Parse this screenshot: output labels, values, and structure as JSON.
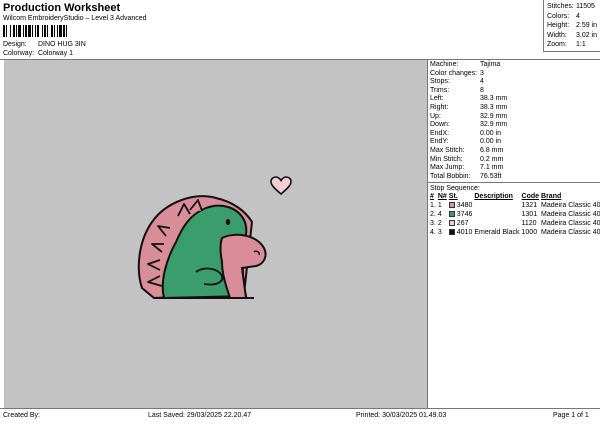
{
  "header": {
    "title": "Production Worksheet",
    "subtitle": "Wilcom EmbroideryStudio – Level 3 Advanced",
    "design_label": "Design:",
    "design_value": "DINO HUG 3IN",
    "colorway_label": "Colorway:",
    "colorway_value": "Colorway 1"
  },
  "stats": [
    {
      "label": "Stitches:",
      "value": "11505"
    },
    {
      "label": "Colors:",
      "value": "4"
    },
    {
      "label": "Height:",
      "value": "2.59 in"
    },
    {
      "label": "Width:",
      "value": "3.02 in"
    },
    {
      "label": "Zoom:",
      "value": "1:1"
    }
  ],
  "params": [
    {
      "label": "Machine:",
      "value": "Tajima"
    },
    {
      "label": "Color changes:",
      "value": "3"
    },
    {
      "label": "Stops:",
      "value": "4"
    },
    {
      "label": "Trims:",
      "value": "8"
    },
    {
      "label": "Left:",
      "value": "38.3 mm"
    },
    {
      "label": "Right:",
      "value": "38.3 mm"
    },
    {
      "label": "Up:",
      "value": "32.9 mm"
    },
    {
      "label": "Down:",
      "value": "32.9 mm"
    },
    {
      "label": "EndX:",
      "value": "0.00 in"
    },
    {
      "label": "EndY:",
      "value": "0.00 in"
    },
    {
      "label": "Max Stitch:",
      "value": "6.8 mm"
    },
    {
      "label": "Min Stitch:",
      "value": "0.2 mm"
    },
    {
      "label": "Max Jump:",
      "value": "7.1 mm"
    },
    {
      "label": "Total Bobbin:",
      "value": "76.53ft"
    }
  ],
  "stop_sequence": {
    "title": "Stop Sequence:",
    "headers": [
      "#",
      "N#",
      "St.",
      "Description",
      "Code",
      "Brand"
    ],
    "rows": [
      {
        "num": "1.",
        "n": "1",
        "swatch": "#d98d99",
        "st": "3480",
        "desc": "",
        "code": "1321",
        "brand": "Madeira Classic 40"
      },
      {
        "num": "2.",
        "n": "4",
        "swatch": "#3b9d6c",
        "st": "3746",
        "desc": "",
        "code": "1301",
        "brand": "Madeira Classic 40"
      },
      {
        "num": "3.",
        "n": "2",
        "swatch": "#f0cfd3",
        "st": "267",
        "desc": "",
        "code": "1120",
        "brand": "Madeira Classic 40"
      },
      {
        "num": "4.",
        "n": "3",
        "swatch": "#111111",
        "st": "4010",
        "desc": "Emerald Black",
        "code": "1000",
        "brand": "Madeira Classic 40"
      }
    ]
  },
  "footer": {
    "created_by": "Created By:",
    "last_saved": "Last Saved: 29/03/2025 22.20.47",
    "printed": "Printed: 30/03/2025 01.49.03",
    "page": "Page 1 of 1"
  },
  "colors": {
    "canvas": "#c3c3c3",
    "pink": "#d98d99",
    "green": "#3b9d6c",
    "light_pink": "#f0cfd3",
    "black": "#111111"
  }
}
